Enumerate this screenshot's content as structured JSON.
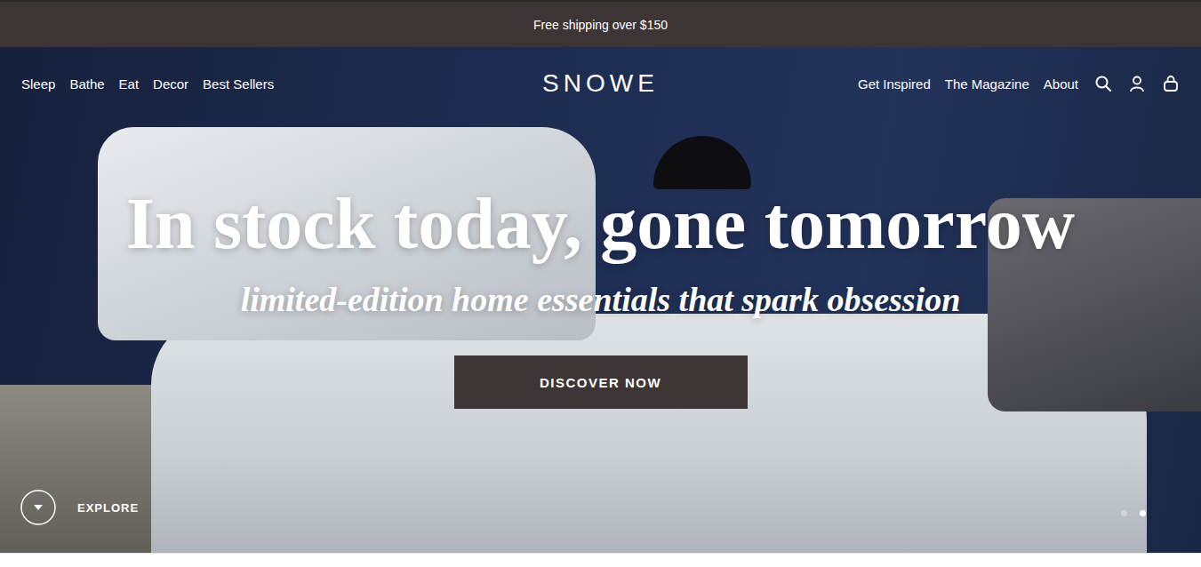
{
  "announcement": "Free shipping over $150",
  "nav": {
    "left": [
      "Sleep",
      "Bathe",
      "Eat",
      "Decor",
      "Best Sellers"
    ],
    "logo": "SNOWE",
    "right": [
      "Get Inspired",
      "The Magazine",
      "About"
    ]
  },
  "hero": {
    "title": "In stock today, gone tomorrow",
    "subtitle": "limited-edition home essentials that spark obsession",
    "button": "DISCOVER NOW",
    "explore": "EXPLORE",
    "slides": [
      {
        "selected": false
      },
      {
        "selected": true
      }
    ]
  }
}
